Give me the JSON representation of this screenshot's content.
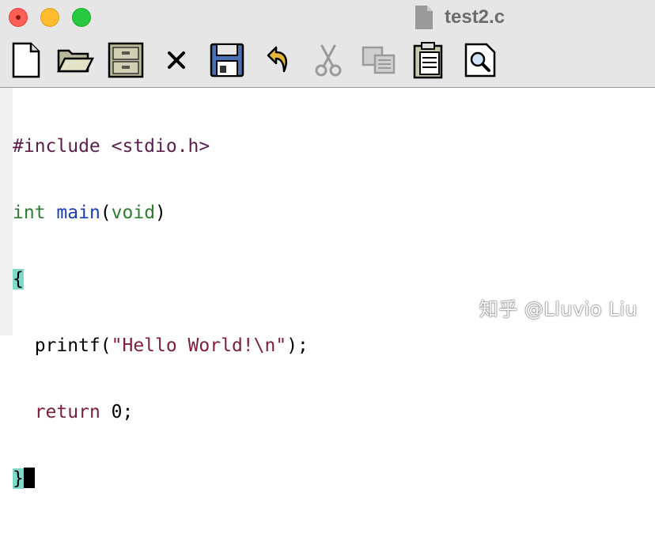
{
  "window": {
    "title": "test2.c",
    "file_icon": "document-icon",
    "traffic_lights": [
      "close",
      "minimize",
      "maximize"
    ]
  },
  "toolbar": {
    "buttons": [
      {
        "name": "new-file",
        "icon": "new-document-icon",
        "enabled": true
      },
      {
        "name": "open-file",
        "icon": "open-folder-icon",
        "enabled": true
      },
      {
        "name": "file-cabinet",
        "icon": "file-cabinet-icon",
        "enabled": true
      },
      {
        "name": "close-file",
        "icon": "close-x-icon",
        "enabled": true
      },
      {
        "name": "save-file",
        "icon": "floppy-disk-icon",
        "enabled": true
      },
      {
        "name": "undo",
        "icon": "undo-arrow-icon",
        "enabled": true
      },
      {
        "name": "cut",
        "icon": "scissors-icon",
        "enabled": false
      },
      {
        "name": "copy",
        "icon": "copy-icon",
        "enabled": false
      },
      {
        "name": "paste",
        "icon": "clipboard-icon",
        "enabled": true
      },
      {
        "name": "find",
        "icon": "magnifier-icon",
        "enabled": true
      }
    ]
  },
  "editor": {
    "lines": [
      {
        "segments": [
          {
            "text": "#include <stdio.h>",
            "kind": "preprocessor"
          }
        ]
      },
      {
        "segments": [
          {
            "text": "int",
            "kind": "keyword"
          },
          {
            "text": " ",
            "kind": "plain"
          },
          {
            "text": "main",
            "kind": "function"
          },
          {
            "text": "(",
            "kind": "plain"
          },
          {
            "text": "void",
            "kind": "keyword"
          },
          {
            "text": ")",
            "kind": "plain"
          }
        ]
      },
      {
        "segments": [
          {
            "text": "{",
            "kind": "brace-match"
          }
        ]
      },
      {
        "segments": [
          {
            "text": "  printf(",
            "kind": "plain"
          },
          {
            "text": "\"Hello World!\\n\"",
            "kind": "string"
          },
          {
            "text": ");",
            "kind": "plain"
          }
        ]
      },
      {
        "segments": [
          {
            "text": "  ",
            "kind": "plain"
          },
          {
            "text": "return",
            "kind": "return"
          },
          {
            "text": " 0;",
            "kind": "plain"
          }
        ]
      },
      {
        "segments": [
          {
            "text": "}",
            "kind": "brace-match"
          }
        ],
        "cursor_after": true
      }
    ],
    "colors": {
      "preprocessor": "#5a1f4a",
      "keyword": "#2e7d32",
      "function": "#1c3db0",
      "string": "#7a1f3d",
      "brace_highlight": "#7fd9c9"
    }
  },
  "watermark": {
    "text": "知乎 @Lluvio Liu"
  }
}
